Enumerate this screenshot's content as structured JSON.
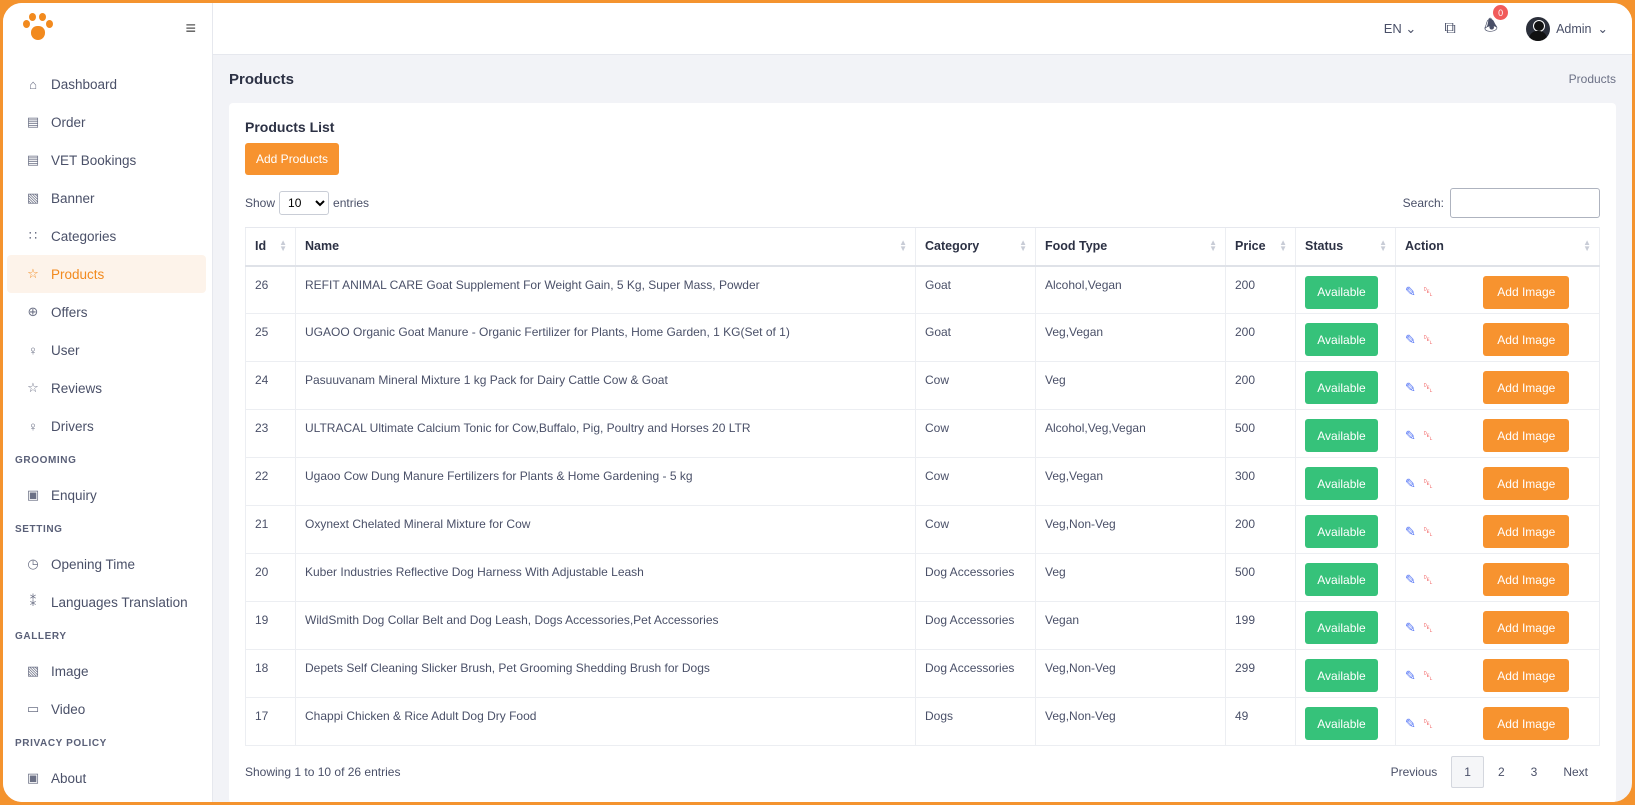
{
  "sidebar": {
    "nav": [
      {
        "label": "Dashboard",
        "icon": "home-icon"
      },
      {
        "label": "Order",
        "icon": "building-icon"
      },
      {
        "label": "VET Bookings",
        "icon": "building-icon"
      },
      {
        "label": "Banner",
        "icon": "image-icon"
      },
      {
        "label": "Categories",
        "icon": "sitemap-icon"
      },
      {
        "label": "Products",
        "icon": "star-icon",
        "active": true
      },
      {
        "label": "Offers",
        "icon": "gift-icon"
      },
      {
        "label": "User",
        "icon": "user-icon"
      },
      {
        "label": "Reviews",
        "icon": "star-icon"
      },
      {
        "label": "Drivers",
        "icon": "user-icon"
      }
    ],
    "sections": {
      "grooming": "GROOMING",
      "setting": "SETTING",
      "gallery": "GALLERY",
      "privacy": "PRIVACY POLICY"
    },
    "grooming_items": [
      {
        "label": "Enquiry"
      }
    ],
    "setting_items": [
      {
        "label": "Opening Time"
      },
      {
        "label": "Languages Translation"
      }
    ],
    "gallery_items": [
      {
        "label": "Image"
      },
      {
        "label": "Video"
      }
    ],
    "privacy_items": [
      {
        "label": "About"
      }
    ]
  },
  "topbar": {
    "language": "EN",
    "notification_count": "0",
    "user_name": "Admin"
  },
  "page": {
    "title": "Products",
    "breadcrumb": "Products",
    "card_title": "Products List",
    "add_button": "Add Products",
    "show_label": "Show",
    "entries_label": "entries",
    "page_size": "10",
    "search_label": "Search:",
    "search_value": ""
  },
  "table": {
    "headers": [
      "Id",
      "Name",
      "Category",
      "Food Type",
      "Price",
      "Status",
      "Action"
    ],
    "rows": [
      {
        "id": "26",
        "name": "REFIT ANIMAL CARE Goat Supplement For Weight Gain, 5 Kg, Super Mass, Powder",
        "category": "Goat",
        "food_type": "Alcohol,Vegan",
        "price": "200",
        "status": "Available"
      },
      {
        "id": "25",
        "name": "UGAOO Organic Goat Manure - Organic Fertilizer for Plants, Home Garden, 1 KG(Set of 1)",
        "category": "Goat",
        "food_type": "Veg,Vegan",
        "price": "200",
        "status": "Available"
      },
      {
        "id": "24",
        "name": "Pasuuvanam Mineral Mixture 1 kg Pack for Dairy Cattle Cow & Goat",
        "category": "Cow",
        "food_type": "Veg",
        "price": "200",
        "status": "Available"
      },
      {
        "id": "23",
        "name": "ULTRACAL Ultimate Calcium Tonic for Cow,Buffalo, Pig, Poultry and Horses 20 LTR",
        "category": "Cow",
        "food_type": "Alcohol,Veg,Vegan",
        "price": "500",
        "status": "Available"
      },
      {
        "id": "22",
        "name": "Ugaoo Cow Dung Manure Fertilizers for Plants & Home Gardening - 5 kg",
        "category": "Cow",
        "food_type": "Veg,Vegan",
        "price": "300",
        "status": "Available"
      },
      {
        "id": "21",
        "name": "Oxynext Chelated Mineral Mixture for Cow",
        "category": "Cow",
        "food_type": "Veg,Non-Veg",
        "price": "200",
        "status": "Available"
      },
      {
        "id": "20",
        "name": "Kuber Industries Reflective Dog Harness With Adjustable Leash",
        "category": "Dog Accessories",
        "food_type": "Veg",
        "price": "500",
        "status": "Available"
      },
      {
        "id": "19",
        "name": "WildSmith Dog Collar Belt and Dog Leash, Dogs Accessories,Pet Accessories",
        "category": "Dog Accessories",
        "food_type": "Vegan",
        "price": "199",
        "status": "Available"
      },
      {
        "id": "18",
        "name": "Depets Self Cleaning Slicker Brush, Pet Grooming Shedding Brush for Dogs",
        "category": "Dog Accessories",
        "food_type": "Veg,Non-Veg",
        "price": "299",
        "status": "Available"
      },
      {
        "id": "17",
        "name": "Chappi Chicken & Rice Adult Dog Dry Food",
        "category": "Dogs",
        "food_type": "Veg,Non-Veg",
        "price": "49",
        "status": "Available"
      }
    ],
    "add_image_label": "Add Image"
  },
  "footer": {
    "info": "Showing 1 to 10 of 26 entries",
    "previous": "Previous",
    "pages": [
      "1",
      "2",
      "3"
    ],
    "next": "Next"
  },
  "colors": {
    "accent": "#f7932f",
    "success": "#36c27a",
    "danger": "#f15b5b"
  }
}
